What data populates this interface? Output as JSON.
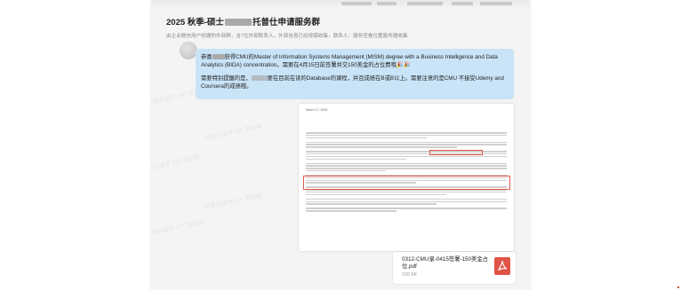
{
  "chat": {
    "group_title_prefix": "2025 秋季-硕士",
    "group_title_suffix": "托普仕申请服务群",
    "group_subtitle": "由企业微信用户创建的外部群，含7位外部联系人，外部信息已经按需收集，联系人：服务查看位置服务器收集",
    "watermark_text": "托普仕留学 VIP 服务群"
  },
  "message": {
    "para1_part1": "恭喜",
    "para1_part2": "获得CMU的Master of Information Systems Management (MISM) degree with a Business Intelligence and Data Analytics (BIDA) concentration。需要在4月15日前签署并交150美金的占位费哦",
    "para1_emoji": "🎉🎉",
    "para2_part1": "需要特别提醒的是，",
    "para2_part2": "要在目前在读的Database的课程，并且成绩在B或B以上。需要注意的是CMU 不接受Udemy and Coursera的成绩哦。"
  },
  "document": {
    "date": "March 17, 2025"
  },
  "attachment": {
    "file_name": "0312-CMU录-0415签署-150美金占位.pdf",
    "file_size": "150.6K",
    "accent_color": "#e25345",
    "download_color": "#2aae67",
    "icons": [
      "download-icon",
      "pdf-file-icon"
    ]
  }
}
